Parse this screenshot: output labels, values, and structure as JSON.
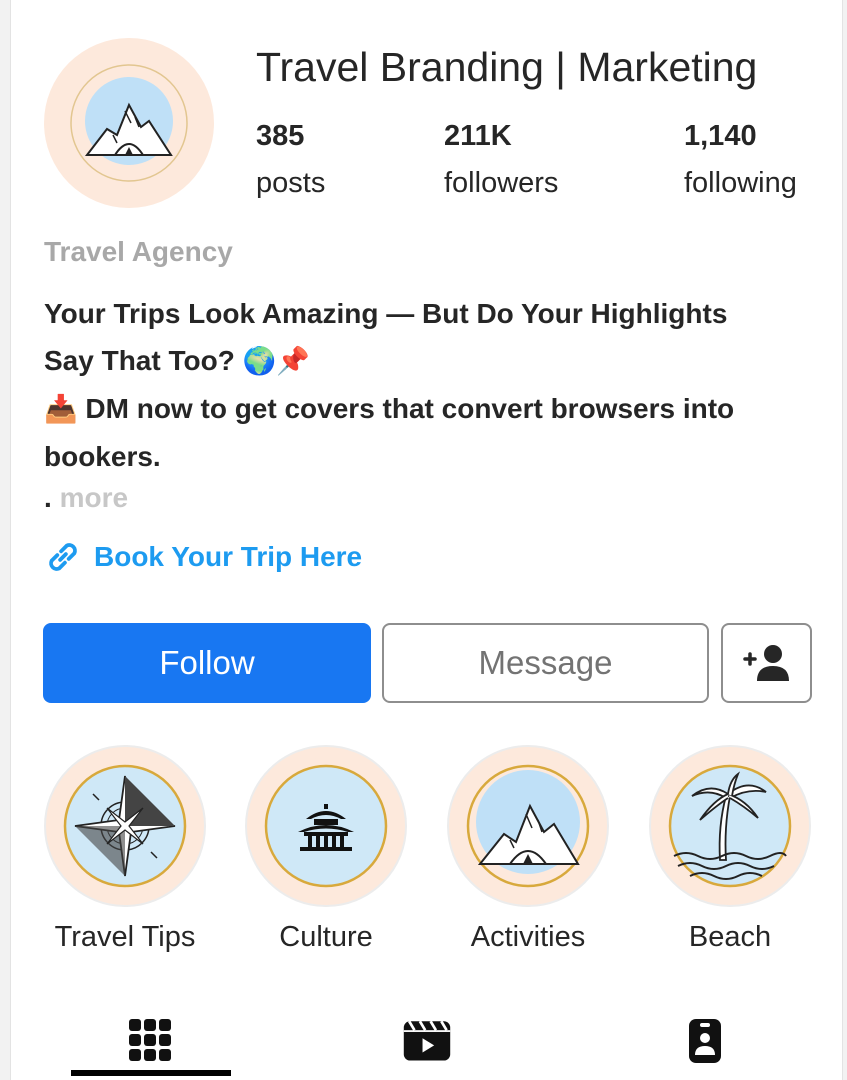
{
  "profile": {
    "username": "Travel Branding | Marketing",
    "avatar_icon": "mountain-tent-icon",
    "stats": [
      {
        "value": "385",
        "label": "posts"
      },
      {
        "value": "211K",
        "label": "followers"
      },
      {
        "value": "1,140",
        "label": "following"
      }
    ],
    "category": "Travel Agency",
    "bio": {
      "line1": " Your Trips Look Amazing — But Do Your Highlights",
      "line2": "Say That Too?",
      "line2_emoji": "🌍📌",
      "line3_emoji": "📥",
      "line3": " DM now to get covers that convert browsers into",
      "line4": "bookers.",
      "dot": ".",
      "more": "more"
    },
    "link_text": "Book Your Trip Here"
  },
  "actions": {
    "follow": "Follow",
    "message": "Message",
    "add_user_icon": "add-person-icon"
  },
  "highlights": [
    {
      "label": "Travel Tips",
      "icon": "compass-icon"
    },
    {
      "label": "Culture",
      "icon": "temple-icon"
    },
    {
      "label": "Activities",
      "icon": "mountain-tent-icon"
    },
    {
      "label": "Beach",
      "icon": "palm-tree-icon"
    }
  ],
  "tabs": [
    {
      "name": "grid",
      "icon": "grid-icon",
      "active": true
    },
    {
      "name": "reels",
      "icon": "reels-icon",
      "active": false
    },
    {
      "name": "tagged",
      "icon": "tagged-icon",
      "active": false
    }
  ],
  "colors": {
    "accent": "#1877f2",
    "link": "#1d9bf0",
    "highlight_bg": "#fde9dc",
    "badge_sky": "#cfe8f7"
  }
}
